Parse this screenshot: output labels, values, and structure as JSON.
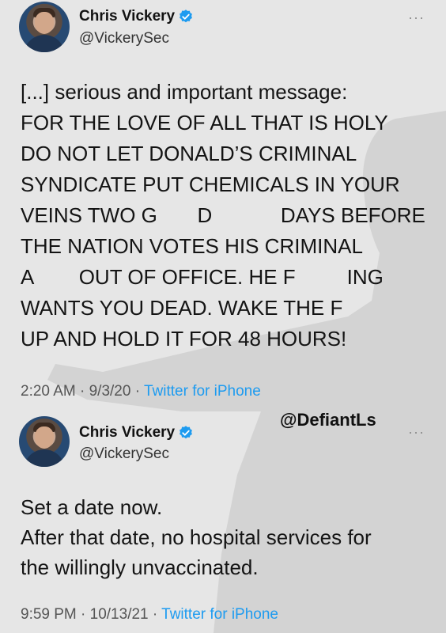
{
  "tweets": [
    {
      "author_name": "Chris Vickery",
      "author_handle": "@VickerySec",
      "more_icon": "···",
      "lines": [
        "[...] serious and important message:",
        "FOR THE LOVE OF ALL THAT IS HOLY",
        "DO NOT LET DONALD’S CRIMINAL",
        "SYNDICATE PUT CHEMICALS IN YOUR",
        "VEINS TWO G       D            DAYS BEFORE",
        "THE NATION VOTES HIS CRIMINAL",
        "A        OUT OF OFFICE. HE F         ING",
        "WANTS YOU DEAD. WAKE THE F",
        "UP AND HOLD IT FOR 48 HOURS!"
      ],
      "timestamp": "2:20 AM · 9/3/20 · ",
      "source": "Twitter for iPhone"
    },
    {
      "author_name": "Chris Vickery",
      "author_handle": "@VickerySec",
      "more_icon": "···",
      "lines": [
        "Set a date now.",
        "After that date, no hospital services for",
        "the willingly unvaccinated."
      ],
      "timestamp": "9:59 PM · 10/13/21 · ",
      "source": "Twitter for iPhone"
    }
  ],
  "watermark": "@DefiantLs",
  "colors": {
    "verified": "#1d9bf0",
    "source_link": "#1d9bf0",
    "background": "#e6e6e6"
  },
  "icons": {
    "verified": "verified-badge-icon",
    "more": "more-options-icon"
  }
}
